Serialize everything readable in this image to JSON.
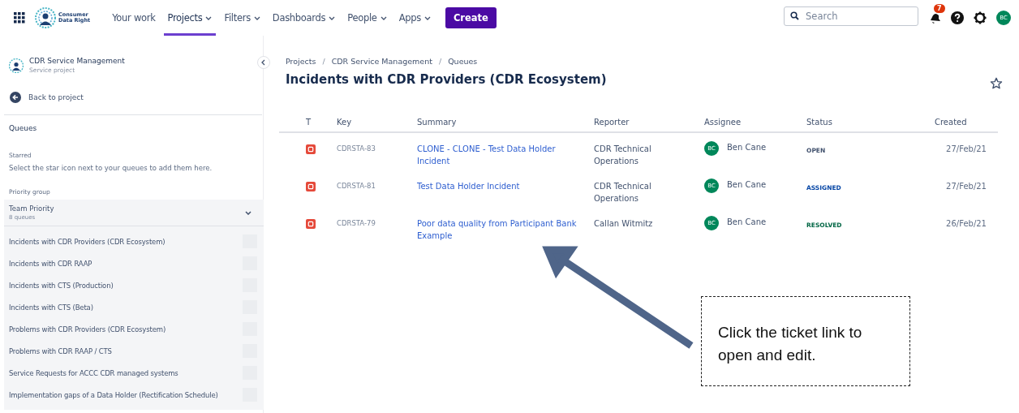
{
  "topnav": {
    "logo_text": [
      "Consumer",
      "Data Right"
    ],
    "items": [
      {
        "label": "Your work",
        "dropdown": false,
        "selected": false
      },
      {
        "label": "Projects",
        "dropdown": true,
        "selected": true
      },
      {
        "label": "Filters",
        "dropdown": true,
        "selected": false
      },
      {
        "label": "Dashboards",
        "dropdown": true,
        "selected": false
      },
      {
        "label": "People",
        "dropdown": true,
        "selected": false
      },
      {
        "label": "Apps",
        "dropdown": true,
        "selected": false
      }
    ],
    "create_button": "Create",
    "search": {
      "placeholder": "Search"
    },
    "notification_count": "7",
    "avatar_initials": "BC"
  },
  "sidebar": {
    "project_name": "CDR Service Management",
    "project_type": "Service project",
    "back_link": "Back to project",
    "queues_heading": "Queues",
    "starred_heading": "Starred",
    "starred_hint": "Select the star icon next to your queues to add them here.",
    "priority_heading": "Priority group",
    "group": {
      "name": "Team Priority",
      "count": "8 queues",
      "expanded": true
    },
    "queues": [
      {
        "label": "Incidents with CDR Providers (CDR Ecosystem)"
      },
      {
        "label": "Incidents with CDR RAAP"
      },
      {
        "label": "Incidents with CTS (Production)"
      },
      {
        "label": "Incidents with CTS (Beta)"
      },
      {
        "label": "Problems with CDR Providers (CDR Ecosystem)"
      },
      {
        "label": "Problems with CDR RAAP / CTS"
      },
      {
        "label": "Service Requests for ACCC CDR managed systems"
      },
      {
        "label": "Implementation gaps of a Data Holder (Rectification Schedule)"
      }
    ]
  },
  "breadcrumbs": [
    {
      "kind": "link",
      "text": "Projects"
    },
    {
      "kind": "separator",
      "text": "/"
    },
    {
      "kind": "link",
      "text": "CDR Service Management"
    },
    {
      "kind": "separator",
      "text": "/"
    },
    {
      "kind": "link",
      "text": "Queues"
    }
  ],
  "page_title": "Incidents with CDR Providers (CDR Ecosystem)",
  "table": {
    "columns": [
      "T",
      "Key",
      "Summary",
      "Reporter",
      "Assignee",
      "Status",
      "Created"
    ],
    "rows": [
      {
        "key": "CDRSTA-83",
        "summary": "CLONE - CLONE - Test Data Holder Incident",
        "reporter": "CDR Technical Operations",
        "assignee_initials": "BC",
        "assignee": "Ben Cane",
        "status": {
          "label": "OPEN",
          "kind": "open"
        },
        "created": "27/Feb/21"
      },
      {
        "key": "CDRSTA-81",
        "summary": "Test Data Holder Incident",
        "reporter": "CDR Technical Operations",
        "assignee_initials": "BC",
        "assignee": "Ben Cane",
        "status": {
          "label": "ASSIGNED",
          "kind": "assigned"
        },
        "created": "27/Feb/21"
      },
      {
        "key": "CDRSTA-79",
        "summary": "Poor data quality from Participant Bank Example",
        "reporter": "Callan Witmitz",
        "assignee_initials": "BC",
        "assignee": "Ben Cane",
        "status": {
          "label": "RESOLVED",
          "kind": "resolved"
        },
        "created": "26/Feb/21"
      }
    ]
  },
  "annotation": {
    "text": "Click the ticket link to open and edit."
  }
}
